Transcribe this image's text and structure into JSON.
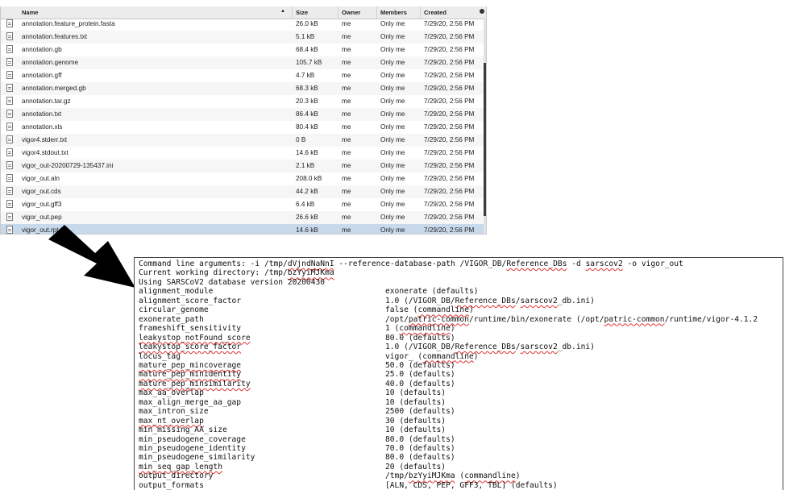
{
  "file_list": {
    "headers": {
      "name": "Name",
      "size": "Size",
      "owner": "Owner",
      "members": "Members",
      "created": "Created"
    },
    "rows": [
      {
        "name": "annotation.feature_protein.fasta",
        "size": "26.0 kB",
        "owner": "me",
        "members": "Only me",
        "created": "7/29/20, 2:56 PM"
      },
      {
        "name": "annotation.features.txt",
        "size": "5.1 kB",
        "owner": "me",
        "members": "Only me",
        "created": "7/29/20, 2:56 PM"
      },
      {
        "name": "annotation.gb",
        "size": "68.4 kB",
        "owner": "me",
        "members": "Only me",
        "created": "7/29/20, 2:56 PM"
      },
      {
        "name": "annotation.genome",
        "size": "105.7 kB",
        "owner": "me",
        "members": "Only me",
        "created": "7/29/20, 2:56 PM"
      },
      {
        "name": "annotation.gff",
        "size": "4.7 kB",
        "owner": "me",
        "members": "Only me",
        "created": "7/29/20, 2:56 PM"
      },
      {
        "name": "annotation.merged.gb",
        "size": "68.3 kB",
        "owner": "me",
        "members": "Only me",
        "created": "7/29/20, 2:56 PM"
      },
      {
        "name": "annotation.tar.gz",
        "size": "20.3 kB",
        "owner": "me",
        "members": "Only me",
        "created": "7/29/20, 2:56 PM"
      },
      {
        "name": "annotation.txt",
        "size": "86.4 kB",
        "owner": "me",
        "members": "Only me",
        "created": "7/29/20, 2:56 PM"
      },
      {
        "name": "annotation.xls",
        "size": "80.4 kB",
        "owner": "me",
        "members": "Only me",
        "created": "7/29/20, 2:56 PM"
      },
      {
        "name": "vigor4.stderr.txt",
        "size": "0 B",
        "owner": "me",
        "members": "Only me",
        "created": "7/29/20, 2:56 PM"
      },
      {
        "name": "vigor4.stdout.txt",
        "size": "14.6 kB",
        "owner": "me",
        "members": "Only me",
        "created": "7/29/20, 2:56 PM"
      },
      {
        "name": "vigor_out-20200729-135437.ini",
        "size": "2.1 kB",
        "owner": "me",
        "members": "Only me",
        "created": "7/29/20, 2:56 PM"
      },
      {
        "name": "vigor_out.aln",
        "size": "208.0 kB",
        "owner": "me",
        "members": "Only me",
        "created": "7/29/20, 2:56 PM"
      },
      {
        "name": "vigor_out.cds",
        "size": "44.2 kB",
        "owner": "me",
        "members": "Only me",
        "created": "7/29/20, 2:56 PM"
      },
      {
        "name": "vigor_out.gff3",
        "size": "6.4 kB",
        "owner": "me",
        "members": "Only me",
        "created": "7/29/20, 2:56 PM"
      },
      {
        "name": "vigor_out.pep",
        "size": "26.6 kB",
        "owner": "me",
        "members": "Only me",
        "created": "7/29/20, 2:56 PM"
      },
      {
        "name": "vigor_out.rpt",
        "size": "14.6 kB",
        "owner": "me",
        "members": "Only me",
        "created": "7/29/20, 2:56 PM",
        "selected": true
      }
    ]
  },
  "terminal": {
    "header_lines": [
      "Command line arguments: -i /tmp/dVjndNaNnI --reference-database-path /VIGOR_DB/Reference_DBs -d sarscov2 -o vigor_out",
      "Current working directory: /tmp/bzYyiMJKma",
      "Using SARSCoV2 database version 20200430"
    ],
    "params": [
      {
        "key": "alignment_module",
        "value": "exonerate (defaults)"
      },
      {
        "key": "alignment_score_factor",
        "value": "1.0 (/VIGOR_DB/Reference_DBs/sarscov2_db.ini)"
      },
      {
        "key": "circular_genome",
        "value": "false (commandline)"
      },
      {
        "key": "exonerate_path",
        "value": "/opt/patric-common/runtime/bin/exonerate (/opt/patric-common/runtime/vigor-4.1.2"
      },
      {
        "key": "frameshift_sensitivity",
        "value": "1 (commandline)"
      },
      {
        "key": "leakystop_notFound_score",
        "value": "80.0 (defaults)"
      },
      {
        "key": "leakystop_score_factor",
        "value": "1.0 (/VIGOR_DB/Reference_DBs/sarscov2_db.ini)"
      },
      {
        "key": "locus_tag",
        "value": "vigor_ (commandline)"
      },
      {
        "key": "mature_pep_mincoverage",
        "value": "50.0 (defaults)"
      },
      {
        "key": "mature_pep_minidentity",
        "value": "25.0 (defaults)"
      },
      {
        "key": "mature_pep_minsimilarity",
        "value": "40.0 (defaults)"
      },
      {
        "key": "max_aa_overlap",
        "value": "10 (defaults)"
      },
      {
        "key": "max_align_merge_aa_gap",
        "value": "10 (defaults)"
      },
      {
        "key": "max_intron_size",
        "value": "2500 (defaults)"
      },
      {
        "key": "max_nt_overlap",
        "value": "30 (defaults)"
      },
      {
        "key": "min_missing_AA_size",
        "value": "10 (defaults)"
      },
      {
        "key": "min_pseudogene_coverage",
        "value": "80.0 (defaults)"
      },
      {
        "key": "min_pseudogene_identity",
        "value": "70.0 (defaults)"
      },
      {
        "key": "min_pseudogene_similarity",
        "value": "80.0 (defaults)"
      },
      {
        "key": "min_seq_gap_length",
        "value": "20 (defaults)"
      },
      {
        "key": "output_directory",
        "value": "/tmp/bzYyiMJKma (commandline)"
      },
      {
        "key": "output_formats",
        "value": "[ALN, CDS, PEP, GFF3, TBL] (defaults)"
      }
    ]
  }
}
